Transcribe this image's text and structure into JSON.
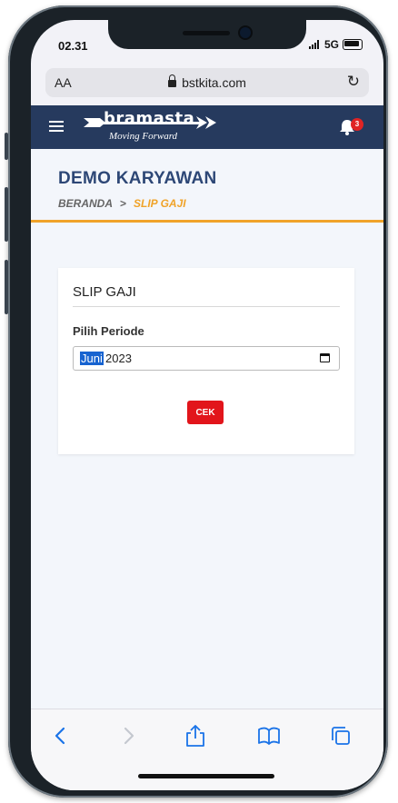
{
  "status_bar": {
    "time": "02.31",
    "network": "5G"
  },
  "browser": {
    "aa_label": "AA",
    "url": "bstkita.com"
  },
  "navbar": {
    "logo_text": "bramasta",
    "logo_tagline": "Moving Forward",
    "notification_count": "3"
  },
  "page": {
    "title": "DEMO KARYAWAN",
    "breadcrumb": {
      "home": "BERANDA",
      "separator": ">",
      "current": "SLIP GAJI"
    }
  },
  "card": {
    "title": "SLIP GAJI",
    "period_label": "Pilih Periode",
    "period_month": "Juni",
    "period_year": "2023",
    "submit_label": "CEK"
  },
  "colors": {
    "navbar": "#263a5e",
    "title": "#2d4776",
    "accent": "#f0a329",
    "button": "#e2151b",
    "link_blue": "#1a73e8"
  },
  "icons": [
    "menu-icon",
    "bell-icon",
    "lock-icon",
    "reload-icon",
    "calendar-icon",
    "back-icon",
    "forward-icon",
    "share-icon",
    "bookmarks-icon",
    "tabs-icon"
  ]
}
